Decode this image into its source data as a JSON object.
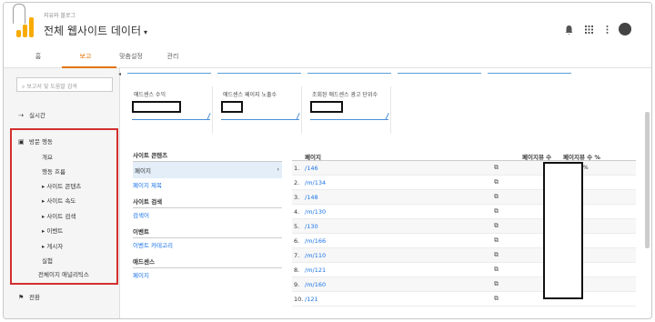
{
  "header": {
    "account_sub": "지유와 블로그",
    "account_title": "전체 웹사이트 데이터",
    "caret": "▾",
    "icons": [
      "bell-icon",
      "apps-grid-icon",
      "more-vert-icon",
      "avatar"
    ]
  },
  "tabs": [
    "홈",
    "보고",
    "맞춤설정",
    "관리"
  ],
  "sidebar": {
    "search_placeholder": "보고서 및 도움말 검색",
    "realtime": "실시간",
    "visit_behavior": "방문 행동",
    "subitems": [
      "개요",
      "행동 흐름",
      "▸ 사이트 콘텐츠",
      "▸ 사이트 속도",
      "▸ 사이트 검색",
      "▸ 이벤트",
      "▸ 게시자",
      "실험",
      "전체이지 애널리틱스"
    ],
    "conversion": "전환"
  },
  "cards": [
    {
      "label": "애드센스 수익"
    },
    {
      "label": "애드센스 페이지 노출수"
    },
    {
      "label": "조회된 애드센스 광고 단위수"
    }
  ],
  "left_table": {
    "sections": [
      {
        "title": "사이트 콘텐츠",
        "items": [
          "페이지",
          "페이지 제목"
        ]
      },
      {
        "title": "사이트 검색",
        "items": [
          "검색어"
        ]
      },
      {
        "title": "이벤트",
        "items": [
          "이벤트 카테고리"
        ]
      },
      {
        "title": "애드센스",
        "items": [
          "페이지"
        ]
      }
    ]
  },
  "right_table": {
    "col_page": "페이지",
    "col_views": "페이지뷰 수",
    "col_pct": "페이지뷰 수 %",
    "rows": [
      {
        "num": "1.",
        "page": "/146"
      },
      {
        "num": "2.",
        "page": "/m/134"
      },
      {
        "num": "3.",
        "page": "/148"
      },
      {
        "num": "4.",
        "page": "/m/130"
      },
      {
        "num": "5.",
        "page": "/130"
      },
      {
        "num": "6.",
        "page": "/m/166"
      },
      {
        "num": "7.",
        "page": "/m/110"
      },
      {
        "num": "8.",
        "page": "/m/121"
      },
      {
        "num": "9.",
        "page": "/m/160"
      },
      {
        "num": "10.",
        "page": "/121"
      }
    ],
    "pct_fragment": "%"
  },
  "accent": "#e37400",
  "link_color": "#1a73e8",
  "highlight_box_color": "#d32f2f"
}
